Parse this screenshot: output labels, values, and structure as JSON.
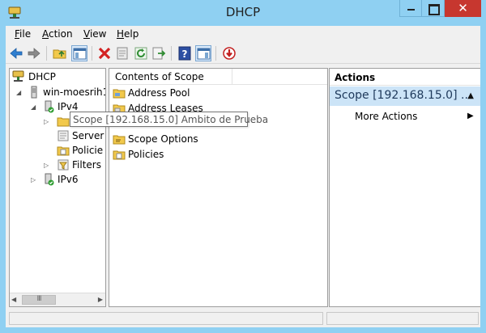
{
  "window": {
    "title": "DHCP",
    "close_glyph": "✕"
  },
  "menu": [
    {
      "label": "File",
      "accel": "F",
      "rest": "ile"
    },
    {
      "label": "Action",
      "accel": "A",
      "rest": "ction"
    },
    {
      "label": "View",
      "accel": "V",
      "rest": "iew"
    },
    {
      "label": "Help",
      "accel": "H",
      "rest": "elp"
    }
  ],
  "toolbar": {
    "icons": [
      "back-arrow-icon",
      "forward-arrow-icon",
      "up-folder-icon",
      "show-hide-console-tree-icon",
      "delete-icon",
      "properties-icon",
      "refresh-icon",
      "export-list-icon",
      "help-icon",
      "show-hide-action-pane-icon",
      "deactivate-icon"
    ]
  },
  "tree": {
    "root": "DHCP",
    "server": "win-moesrih1",
    "ipv4": "IPv4",
    "scope_truncated": "",
    "server_options": "Server",
    "policies": "Policie",
    "filters": "Filters",
    "ipv6": "IPv6",
    "scroll_thumb": "III"
  },
  "tooltip": "Scope [192.168.15.0] Ambito de Prueba",
  "contents": {
    "header": "Contents of Scope",
    "items": [
      {
        "label": "Address Pool"
      },
      {
        "label": "Address Leases"
      },
      {
        "label": "Scope Options"
      },
      {
        "label": "Policies"
      }
    ]
  },
  "actions": {
    "header": "Actions",
    "section": "Scope [192.168.15.0] ...",
    "items": [
      {
        "label": "More Actions"
      }
    ]
  },
  "colors": {
    "title_bar": "#8fd0f2",
    "close_button": "#c7372f",
    "actions_highlight": "#cce4f7",
    "folder_yellow": "#f2c94c"
  }
}
